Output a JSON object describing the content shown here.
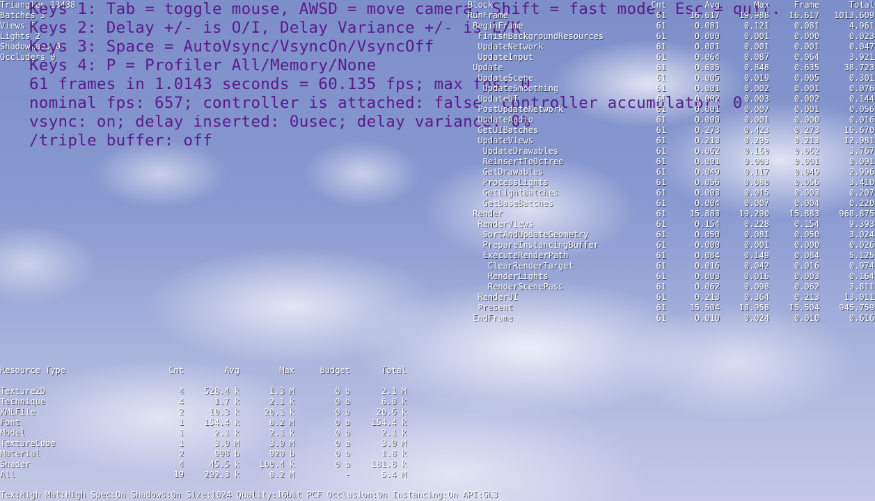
{
  "stats": [
    "Triangles 13438",
    "Batches 3",
    "Views 1",
    "Lights 2",
    "Shadowmaps 0",
    "Occluders 0"
  ],
  "help_lines": [
    "Keys 1: Tab = toggle mouse, AWSD = move camera, Shift = fast mode, Esc = quit.",
    "Keys 2: Delay +/- is O/I, Delay Variance +/- is L/K",
    "Keys 3: Space = AutoVsync/VsyncOn/VsyncOff",
    "Keys 4: P = Profiler All/Memory/None",
    "61 frames in 1.0143 seconds = 60.135 fps; max fps: 0",
    "nominal fps: 657; controller is attached: false  controller accumulator: 0",
    "vsync: on; delay inserted: 0usec; delay variance: 0%",
    "/triple buffer: off"
  ],
  "profiler": {
    "headers": [
      "Block",
      "Cnt",
      "Avg",
      "Max",
      "Frame",
      "Total"
    ],
    "rows": [
      {
        "name": "RunFrame",
        "cnt": "61",
        "avg": "16.617",
        "max": "19.988",
        "frame": "16.617",
        "total": "1013.609"
      },
      {
        "name": " BeginFrame",
        "cnt": "61",
        "avg": "0.081",
        "max": "0.121",
        "frame": "0.081",
        "total": "4.961"
      },
      {
        "name": "  FinishBackgroundResources",
        "cnt": "61",
        "avg": "0.000",
        "max": "0.001",
        "frame": "0.000",
        "total": "0.023"
      },
      {
        "name": "  UpdateNetwork",
        "cnt": "61",
        "avg": "0.001",
        "max": "0.001",
        "frame": "0.001",
        "total": "0.047"
      },
      {
        "name": "  UpdateInput",
        "cnt": "61",
        "avg": "0.064",
        "max": "0.087",
        "frame": "0.064",
        "total": "3.921"
      },
      {
        "name": " Update",
        "cnt": "61",
        "avg": "0.635",
        "max": "0.848",
        "frame": "0.635",
        "total": "38.723"
      },
      {
        "name": "  UpdateScene",
        "cnt": "61",
        "avg": "0.005",
        "max": "0.019",
        "frame": "0.005",
        "total": "0.301"
      },
      {
        "name": "   UpdateSmoothing",
        "cnt": "61",
        "avg": "0.001",
        "max": "0.002",
        "frame": "0.001",
        "total": "0.076"
      },
      {
        "name": "  UpdateUI",
        "cnt": "61",
        "avg": "0.002",
        "max": "0.003",
        "frame": "0.002",
        "total": "0.144"
      },
      {
        "name": "  PostUpdateNetwork",
        "cnt": "61",
        "avg": "0.001",
        "max": "0.007",
        "frame": "0.001",
        "total": "0.056"
      },
      {
        "name": "  UpdateAudio",
        "cnt": "61",
        "avg": "0.000",
        "max": "0.001",
        "frame": "0.000",
        "total": "0.016"
      },
      {
        "name": "  GetUIBatches",
        "cnt": "61",
        "avg": "0.273",
        "max": "0.423",
        "frame": "0.273",
        "total": "16.670"
      },
      {
        "name": "  UpdateViews",
        "cnt": "61",
        "avg": "0.213",
        "max": "0.295",
        "frame": "0.213",
        "total": "12.981"
      },
      {
        "name": "   UpdateDrawables",
        "cnt": "61",
        "avg": "0.062",
        "max": "0.160",
        "frame": "0.062",
        "total": "3.767"
      },
      {
        "name": "   ReinsertToOctree",
        "cnt": "61",
        "avg": "0.001",
        "max": "0.003",
        "frame": "0.001",
        "total": "0.091"
      },
      {
        "name": "   GetDrawables",
        "cnt": "61",
        "avg": "0.049",
        "max": "0.117",
        "frame": "0.049",
        "total": "2.996"
      },
      {
        "name": "   ProcessLights",
        "cnt": "61",
        "avg": "0.056",
        "max": "0.080",
        "frame": "0.056",
        "total": "3.410"
      },
      {
        "name": "   GetLightBatches",
        "cnt": "61",
        "avg": "0.003",
        "max": "0.015",
        "frame": "0.003",
        "total": "0.207"
      },
      {
        "name": "   GetBaseBatches",
        "cnt": "61",
        "avg": "0.004",
        "max": "0.007",
        "frame": "0.004",
        "total": "0.220"
      },
      {
        "name": " Render",
        "cnt": "61",
        "avg": "15.883",
        "max": "19.290",
        "frame": "15.883",
        "total": "968.875"
      },
      {
        "name": "  RenderViews",
        "cnt": "61",
        "avg": "0.154",
        "max": "0.228",
        "frame": "0.154",
        "total": "9.393"
      },
      {
        "name": "   SortAndUpdateGeometry",
        "cnt": "61",
        "avg": "0.050",
        "max": "0.081",
        "frame": "0.050",
        "total": "3.024"
      },
      {
        "name": "   PrepareInstancingBuffer",
        "cnt": "61",
        "avg": "0.000",
        "max": "0.001",
        "frame": "0.000",
        "total": "0.026"
      },
      {
        "name": "   ExecuteRenderPath",
        "cnt": "61",
        "avg": "0.084",
        "max": "0.149",
        "frame": "0.084",
        "total": "5.125"
      },
      {
        "name": "    ClearRenderTarget",
        "cnt": "61",
        "avg": "0.016",
        "max": "0.042",
        "frame": "0.016",
        "total": "0.974"
      },
      {
        "name": "    RenderLights",
        "cnt": "61",
        "avg": "0.003",
        "max": "0.016",
        "frame": "0.003",
        "total": "0.164"
      },
      {
        "name": "    RenderScenePass",
        "cnt": "61",
        "avg": "0.062",
        "max": "0.098",
        "frame": "0.062",
        "total": "3.811"
      },
      {
        "name": "  RenderUI",
        "cnt": "61",
        "avg": "0.213",
        "max": "0.364",
        "frame": "0.213",
        "total": "13.011"
      },
      {
        "name": "  Present",
        "cnt": "61",
        "avg": "15.504",
        "max": "18.958",
        "frame": "15.504",
        "total": "945.759"
      },
      {
        "name": " EndFrame",
        "cnt": "61",
        "avg": "0.010",
        "max": "0.024",
        "frame": "0.010",
        "total": "0.616"
      }
    ]
  },
  "resources": {
    "headers": [
      "Resource Type",
      "Cnt",
      "Avg",
      "Max",
      "Budget",
      "Total"
    ],
    "rows": [
      {
        "type": "Texture2D",
        "cnt": "4",
        "avg": "528.4 k",
        "max": "1.3 M",
        "budget": "0 b",
        "total": "2.1 M"
      },
      {
        "type": "Technique",
        "cnt": "4",
        "avg": "1.7 k",
        "max": "2.1 k",
        "budget": "0 b",
        "total": "6.8 k"
      },
      {
        "type": "XMLFile",
        "cnt": "2",
        "avg": "10.3 k",
        "max": "20.1 k",
        "budget": "0 b",
        "total": "20.6 k"
      },
      {
        "type": "Font",
        "cnt": "1",
        "avg": "154.4 k",
        "max": "8.2 M",
        "budget": "0 b",
        "total": "154.4 k"
      },
      {
        "type": "Model",
        "cnt": "1",
        "avg": "2.1 k",
        "max": "2.1 k",
        "budget": "0 b",
        "total": "2.1 k"
      },
      {
        "type": "TextureCube",
        "cnt": "1",
        "avg": "3.0 M",
        "max": "3.0 M",
        "budget": "0 b",
        "total": "3.0 M"
      },
      {
        "type": "Material",
        "cnt": "2",
        "avg": "908 b",
        "max": "920 b",
        "budget": "0 b",
        "total": "1.8 k"
      },
      {
        "type": "Shader",
        "cnt": "4",
        "avg": "45.5 k",
        "max": "100.4 k",
        "budget": "0 b",
        "total": "181.8 k"
      },
      {
        "type": "All",
        "cnt": "19",
        "avg": "292.3 k",
        "max": "8.2 M",
        "budget": "-",
        "total": "5.4 M"
      }
    ]
  },
  "footer": "Tex:High Mat:High Spec:On Shadows:On Size:1024 Quality:16bit PCF Occlusion:On Instancing:On API:GL3"
}
